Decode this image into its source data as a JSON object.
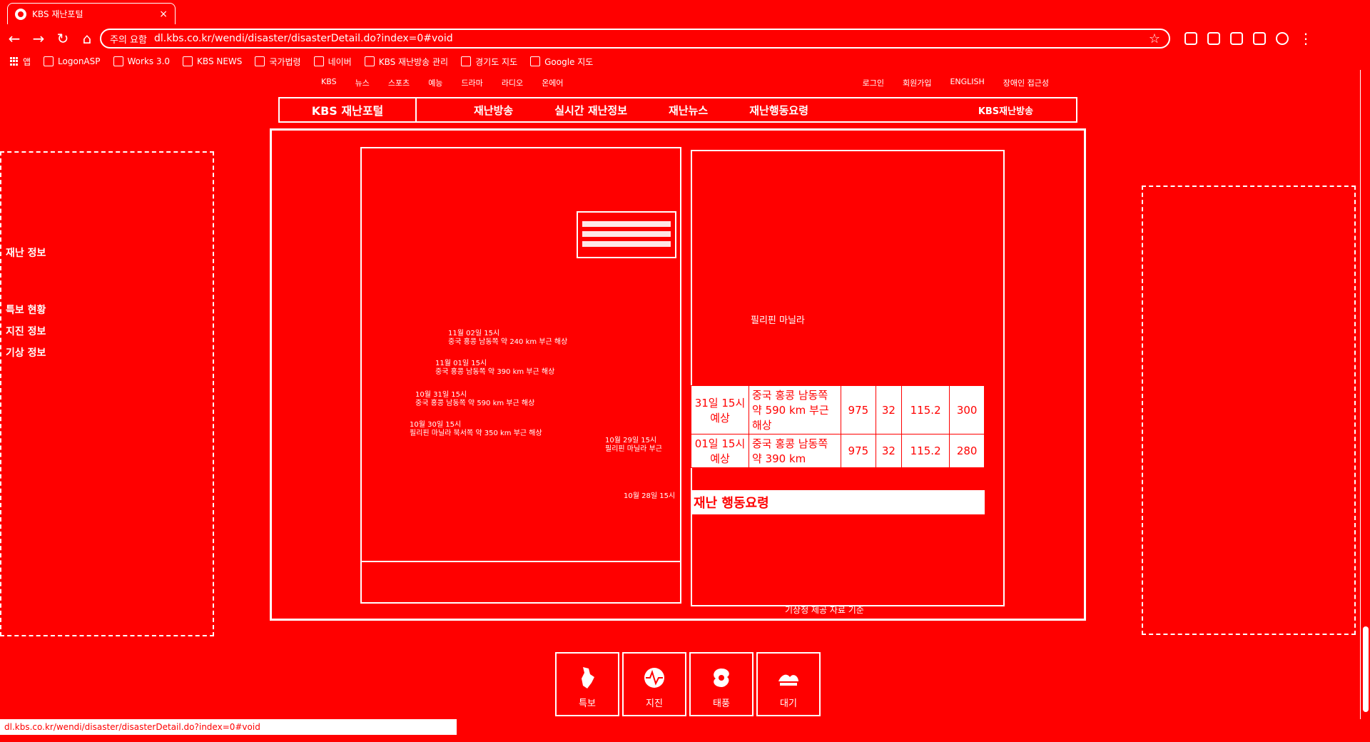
{
  "browser": {
    "tab_title": "KBS 재난포털",
    "close_glyph": "×",
    "url": "dl.kbs.co.kr/wendi/disaster/disasterDetail.do?index=0#void",
    "security_label": "주의 요함",
    "bookmarks": [
      "앱",
      "LogonASP",
      "Works 3.0",
      "KBS NEWS",
      "국가법령",
      "네이버",
      "KBS 재난방송 관리",
      "경기도 지도",
      "Google 지도"
    ]
  },
  "page": {
    "top_links": [
      "KBS",
      "뉴스",
      "스포츠",
      "예능",
      "드라마",
      "라디오",
      "온에어"
    ],
    "top_links_right": [
      "로그인",
      "회원가입",
      "ENGLISH",
      "장애인 접근성"
    ],
    "logo_text": "KBS 재난포털",
    "main_menu": [
      "재난방송",
      "실시간 재난정보",
      "재난뉴스",
      "재난행동요령"
    ],
    "header_right": "KBS재난방송",
    "side_left_lines": [
      "재난 정보",
      "특보 현황",
      "지진 정보",
      "기상 정보"
    ]
  },
  "typhoon_track": [
    {
      "label": "11월 02일 15시",
      "desc": "중국 홍콩 남동쪽 약 240 km 부근 해상"
    },
    {
      "label": "11월 01일 15시",
      "desc": "중국 홍콩 남동쪽 약 390 km 부근 해상"
    },
    {
      "label": "10월 31일 15시",
      "desc": "중국 홍콩 남동쪽 약 590 km 부근 해상"
    },
    {
      "label": "10월 30일 15시",
      "desc": "필리핀 마닐라 북서쪽 약 350 km 부근 해상"
    },
    {
      "label": "10월 29일 15시",
      "desc": "필리핀 마닐라 부근"
    },
    {
      "label": "10월 28일 15시",
      "desc": ""
    }
  ],
  "forecast": {
    "heading": "필리핀 마닐라",
    "rows": [
      {
        "time": "31일 15시 예상",
        "location": "중국 홍콩 남동쪽 약 590 km 부근 해상",
        "pressure": "975",
        "wind": "32",
        "speed": "115.2",
        "radius": "300"
      },
      {
        "time": "01일 15시 예상",
        "location": "중국 홍콩 남동쪽 약 390 km",
        "pressure": "975",
        "wind": "32",
        "speed": "115.2",
        "radius": "280"
      }
    ],
    "section_title": "재난 행동요령",
    "note": "기상청 제공 자료 기준"
  },
  "tiles": [
    {
      "label": "특보"
    },
    {
      "label": "지진"
    },
    {
      "label": "태풍"
    },
    {
      "label": "대기"
    }
  ],
  "status_bar": "dl.kbs.co.kr/wendi/disaster/disasterDetail.do?index=0#void",
  "colors": {
    "primary": "#ff0000",
    "foreground": "#ffffff"
  }
}
